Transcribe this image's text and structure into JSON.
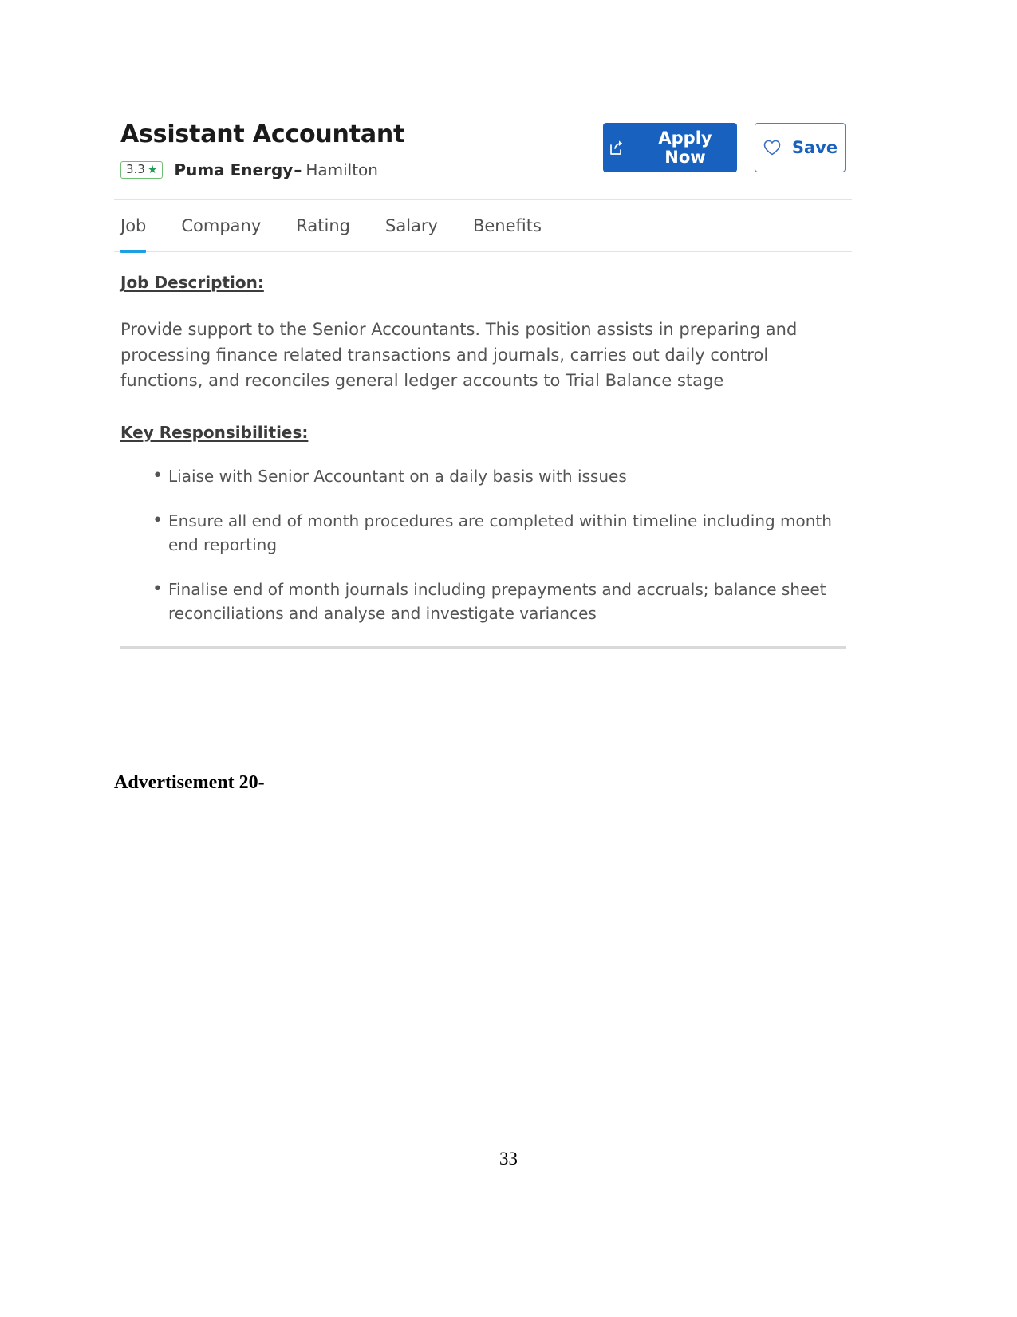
{
  "job": {
    "title": "Assistant Accountant",
    "rating": "3.3",
    "rating_star": "star-icon",
    "employer": "Puma Energy",
    "separator": "–",
    "location": "Hamilton",
    "actions": {
      "apply_label": "Apply Now",
      "apply_icon": "share-icon",
      "save_label": "Save",
      "save_icon": "heart-icon"
    },
    "tabs": [
      {
        "label": "Job",
        "active": true
      },
      {
        "label": "Company",
        "active": false
      },
      {
        "label": "Rating",
        "active": false
      },
      {
        "label": "Salary",
        "active": false
      },
      {
        "label": "Benefits",
        "active": false
      }
    ],
    "description_heading": "Job Description:",
    "description_body": "Provide support to the Senior Accountants. This position assists in preparing and processing finance related transactions and journals, carries out daily control functions, and reconciles general ledger accounts to Trial Balance stage",
    "responsibilities_heading": "Key Responsibilities:",
    "responsibilities": [
      "Liaise with Senior Accountant on a daily basis with issues",
      "Ensure all end of month procedures are completed within timeline including month end reporting",
      "Finalise end of month journals including prepayments and accruals; balance sheet reconciliations and analyse and investigate variances"
    ]
  },
  "document": {
    "advertisement_label": "Advertisement 20-",
    "page_number": "33"
  },
  "colors": {
    "primary_blue": "#1861bf",
    "tab_underline": "#1ca0e3",
    "rating_green": "#1f9d55",
    "body_text": "#545454"
  }
}
